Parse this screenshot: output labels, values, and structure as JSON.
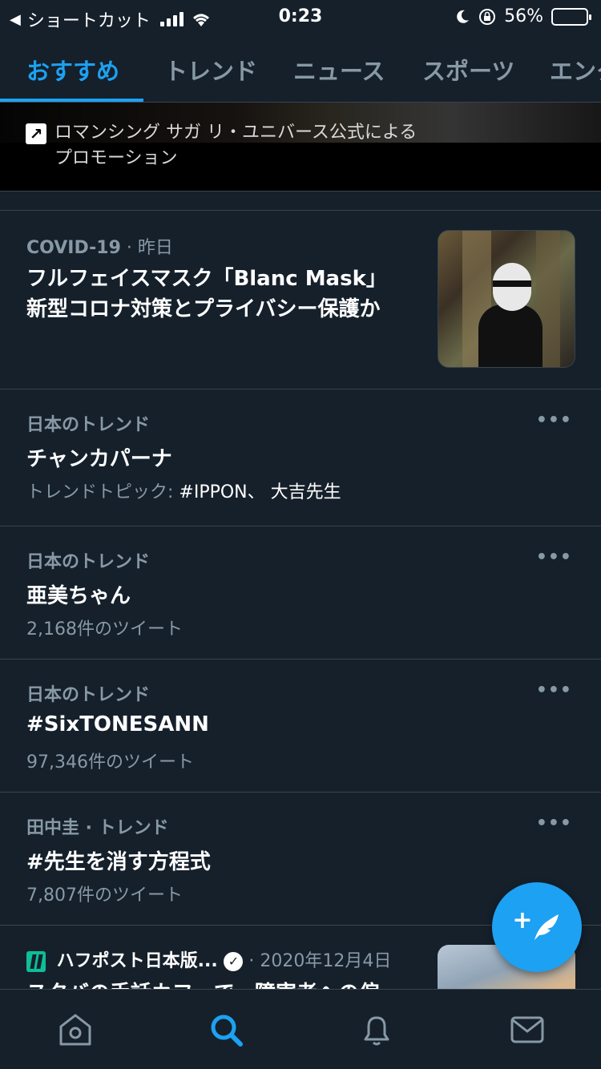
{
  "status": {
    "back_label": "ショートカット",
    "time": "0:23",
    "battery": "56%",
    "battery_level": 0.56
  },
  "tabs": [
    {
      "label": "おすすめ",
      "active": true
    },
    {
      "label": "トレンド",
      "active": false
    },
    {
      "label": "ニュース",
      "active": false
    },
    {
      "label": "スポーツ",
      "active": false
    },
    {
      "label": "エンタ",
      "active": false
    }
  ],
  "promo": {
    "badge": "↗",
    "text_line1": "ロマンシング サガ リ・ユニバース公式による",
    "text_line2": "プロモーション"
  },
  "news_item": {
    "category": "COVID-19",
    "time": " · 昨日",
    "title_line1": "フルフェイスマスク「Blanc Mask」",
    "title_line2": "新型コロナ対策とプライバシー保護か"
  },
  "trends": [
    {
      "context": "日本のトレンド",
      "title": "チャンカパーナ",
      "detail_prefix": "トレンドトピック: ",
      "detail_strong": "#IPPON、 大吉先生",
      "detail": ""
    },
    {
      "context": "日本のトレンド",
      "title": "亜美ちゃん",
      "detail_prefix": "",
      "detail_strong": "",
      "detail": "2,168件のツイート"
    },
    {
      "context": "日本のトレンド",
      "title": "#SixTONESANN",
      "detail_prefix": "",
      "detail_strong": "",
      "detail": "97,346件のツイート"
    },
    {
      "context": "田中圭 · トレンド",
      "title": "#先生を消す方程式",
      "detail_prefix": "",
      "detail_strong": "",
      "detail": "7,807件のツイート"
    }
  ],
  "more_label": "•••",
  "bottom_item": {
    "source": "ハフポスト日本版...",
    "date": " · 2020年12月4日",
    "title": "スタバの手話カフェで、障害者への偏"
  },
  "fab_plus": "+"
}
